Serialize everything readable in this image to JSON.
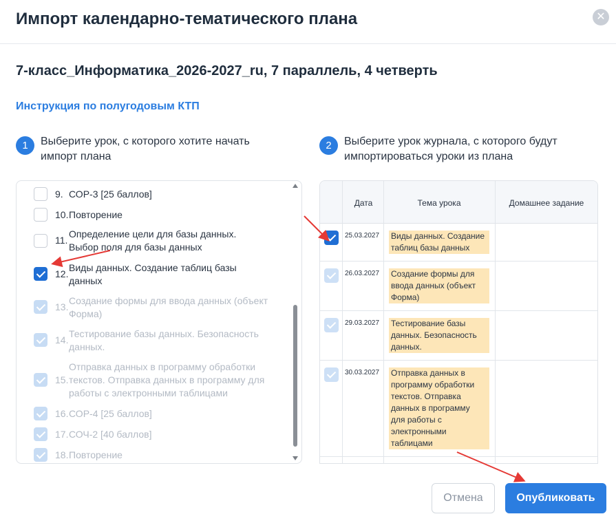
{
  "modal": {
    "title": "Импорт календарно-тематического плана",
    "close_icon": "close-icon"
  },
  "plan_title": "7-класс_Информатика_2026-2027_ru, 7 параллель, 4 четверть",
  "instruction_link": "Инструкция по полугодовым КТП",
  "step1": {
    "number": "1",
    "text_line1": "Выберите урок, с которого хотите начать",
    "text_line2": "импорт плана"
  },
  "step2": {
    "number": "2",
    "text_line1": "Выберите урок журнала, с которого будут",
    "text_line2": "импортироваться уроки из плана"
  },
  "lessons": [
    {
      "num": "9.",
      "line1": "СОР-3 [25 баллов]",
      "line2": "",
      "line3": "",
      "state": "unchecked"
    },
    {
      "num": "10.",
      "line1": "Повторение",
      "line2": "",
      "line3": "",
      "state": "unchecked"
    },
    {
      "num": "11.",
      "line1": "Определение цели для базы данных.",
      "line2": "Выбор поля для базы данных",
      "line3": "",
      "state": "unchecked"
    },
    {
      "num": "12.",
      "line1": "Виды данных. Создание таблиц базы",
      "line2": "данных",
      "line3": "",
      "state": "checked"
    },
    {
      "num": "13.",
      "line1": "Создание формы для ввода данных (объект",
      "line2": "Форма)",
      "line3": "",
      "state": "disabled"
    },
    {
      "num": "14.",
      "line1": "Тестирование базы данных. Безопасность",
      "line2": "данных.",
      "line3": "",
      "state": "disabled"
    },
    {
      "num": "15.",
      "line1": "Отправка данных в программу обработки",
      "line2": "текстов. Отправка данных в программу для",
      "line3": "работы с электронными таблицами",
      "state": "disabled"
    },
    {
      "num": "16.",
      "line1": "СОР-4 [25 баллов]",
      "line2": "",
      "line3": "",
      "state": "disabled"
    },
    {
      "num": "17.",
      "line1": "СОЧ-2 [40 баллов]",
      "line2": "",
      "line3": "",
      "state": "disabled"
    },
    {
      "num": "18.",
      "line1": "Повторение",
      "line2": "",
      "line3": "",
      "state": "disabled"
    }
  ],
  "journal": {
    "headers": {
      "date": "Дата",
      "topic": "Тема урока",
      "homework": "Домашнее задание"
    },
    "rows": [
      {
        "date": "25.03.2027",
        "topic": [
          "Виды данных. Создание",
          "таблиц базы данных"
        ],
        "state": "checked"
      },
      {
        "date": "26.03.2027",
        "topic": [
          "Создание формы для",
          "ввода данных (объект",
          "Форма)"
        ],
        "state": "disabled"
      },
      {
        "date": "29.03.2027",
        "topic": [
          "Тестирование базы",
          "данных. Безопасность",
          "данных."
        ],
        "state": "disabled"
      },
      {
        "date": "30.03.2027",
        "topic": [
          "Отправка данных в",
          "программу обработки",
          "текстов. Отправка",
          "данных в программу",
          "для работы с",
          "электронными",
          "таблицами"
        ],
        "state": "disabled"
      }
    ]
  },
  "buttons": {
    "cancel": "Отмена",
    "publish": "Опубликовать"
  },
  "colors": {
    "accent": "#2b7de0",
    "highlight": "#fde6b8",
    "annotation_arrow": "#e53935"
  }
}
